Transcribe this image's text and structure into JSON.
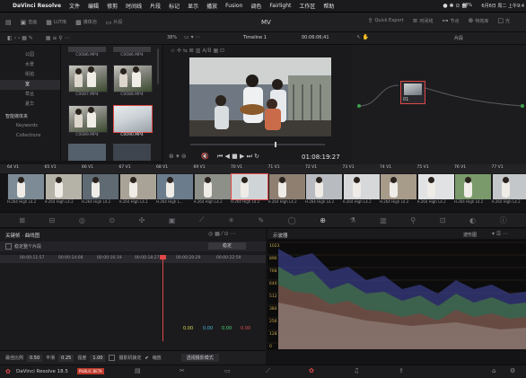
{
  "menubar": {
    "app_name": "DaVinci Resolve",
    "items": [
      "文件",
      "编辑",
      "修剪",
      "时间线",
      "片段",
      "标记",
      "显示",
      "播放",
      "Fusion",
      "调色",
      "Fairlight",
      "工作区",
      "帮助"
    ],
    "battery": "48%",
    "datetime": "6月6日 周二 上午9:4"
  },
  "toolbar": {
    "left": [
      "音画",
      "LUT库",
      "媒体池",
      "片段"
    ],
    "title": "MV",
    "right": [
      "Quick Export",
      "时间线",
      "节点",
      "特效库",
      "光"
    ]
  },
  "subbar": {
    "zoom": "38%",
    "timeline_name": "Timeline 1",
    "timecode": "00:06:06;41",
    "node_mode": "片段"
  },
  "bins": {
    "items": [
      "公园",
      "水景",
      "街拍",
      "室",
      "草丛",
      "夏华"
    ],
    "selected_index": 3,
    "smart_bins_title": "智能媒体夹",
    "smart_items": [
      "Keywords",
      "Collections"
    ]
  },
  "media": {
    "thumbs": [
      {
        "label": "C0086.MP4"
      },
      {
        "label": "C0086.MP4"
      },
      {
        "label": "C0087.MP4"
      },
      {
        "label": "C0088.MP4"
      },
      {
        "label": "C0089.MP4"
      },
      {
        "label": "C0090.MP4"
      }
    ]
  },
  "viewer": {
    "timecode": "01:08:19:27"
  },
  "node": {
    "label": "01"
  },
  "strip": {
    "clips": [
      {
        "num": "64",
        "track": "V1",
        "label": "H.264 High L4.2"
      },
      {
        "num": "65",
        "track": "V1",
        "label": "H.264 High L4.2"
      },
      {
        "num": "66",
        "track": "V1",
        "label": "H.264 High L4.2"
      },
      {
        "num": "67",
        "track": "V1",
        "label": "H.264 High L4.2"
      },
      {
        "num": "68",
        "track": "V1",
        "label": "H.264 High L..."
      },
      {
        "num": "69",
        "track": "V1",
        "label": "H.264 High L4.2"
      },
      {
        "num": "70",
        "track": "V1",
        "label": "H.264 High L4.2"
      },
      {
        "num": "71",
        "track": "V1",
        "label": "H.264 High L4.2"
      },
      {
        "num": "72",
        "track": "V1",
        "label": "H.264 High L4.2"
      },
      {
        "num": "73",
        "track": "V1",
        "label": "H.264 High L4.2"
      },
      {
        "num": "74",
        "track": "V1",
        "label": "H.264 High L4.2"
      },
      {
        "num": "75",
        "track": "V1",
        "label": "H.264 High L4.2"
      },
      {
        "num": "76",
        "track": "V1",
        "label": "H.264 High L4.2"
      },
      {
        "num": "77",
        "track": "V1",
        "label": "H.264 High L4.2"
      }
    ],
    "selected_index": 6
  },
  "keyframes": {
    "title": "关键帧 · 曲线图",
    "row_label": "稳定整个片段",
    "dropdown": "稳定",
    "ruler": [
      "00:00:11:57",
      "00:00:14:08",
      "00:00:16:19",
      "00:00:18:27",
      "00:00:20:29",
      "00:00:22:59"
    ],
    "values": [
      "0.00",
      "0.00",
      "0.00",
      "0.00"
    ]
  },
  "scope": {
    "title": "示波器",
    "mode": "波形图",
    "labels": [
      "1023",
      "896",
      "768",
      "640",
      "512",
      "384",
      "256",
      "128",
      "0"
    ]
  },
  "bottom": {
    "range_label": "最佳比例",
    "range_val": "0.50",
    "smooth_label": "平滑",
    "smooth_val": "0.25",
    "strength_label": "强度",
    "strength_val": "1.00",
    "lock_label": "摄影机锁定",
    "zoom_label": "缩放",
    "mode_label": "透视摄影模式"
  },
  "pages": {
    "app_version": "DaVinci Resolve 18.5",
    "badge": "PUBLIC BETA"
  }
}
